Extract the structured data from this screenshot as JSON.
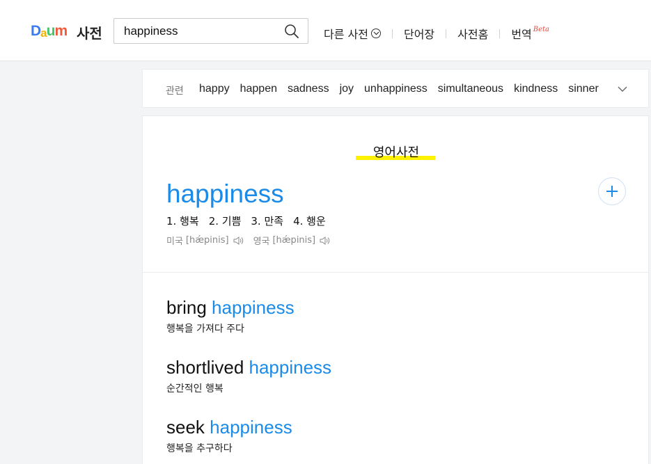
{
  "header": {
    "logo": {
      "d": "D",
      "a": "a",
      "u": "u",
      "m": "m"
    },
    "logo_text": "사전",
    "search": {
      "value": "happiness",
      "placeholder": ""
    },
    "nav": [
      {
        "label": "다른 사전"
      },
      {
        "label": "단어장"
      },
      {
        "label": "사전홈"
      },
      {
        "label": "번역",
        "badge": "Beta"
      }
    ]
  },
  "related": {
    "label": "관련",
    "words": [
      "happy",
      "happen",
      "sadness",
      "joy",
      "unhappiness",
      "simultaneous",
      "kindness",
      "sinner"
    ]
  },
  "dictionary": {
    "title": "영어사전",
    "headword": "happiness",
    "meanings": [
      "1. 행복",
      "2. 기쁨",
      "3. 만족",
      "4. 행운"
    ],
    "pronunciations": [
      {
        "region": "미국",
        "ipa": "[hǽpinis]"
      },
      {
        "region": "영국",
        "ipa": "[hǽpinis]"
      }
    ],
    "phrases": [
      {
        "prefix": "bring ",
        "keyword": "happiness",
        "meaning": "행복을 가져다 주다"
      },
      {
        "prefix": "shortlived ",
        "keyword": "happiness",
        "meaning": "순간적인 행복"
      },
      {
        "prefix": "seek ",
        "keyword": "happiness",
        "meaning": "행복을 추구하다"
      }
    ]
  },
  "colors": {
    "accent": "#1a8be8",
    "highlight": "#fff200",
    "beta": "#e8483c"
  }
}
